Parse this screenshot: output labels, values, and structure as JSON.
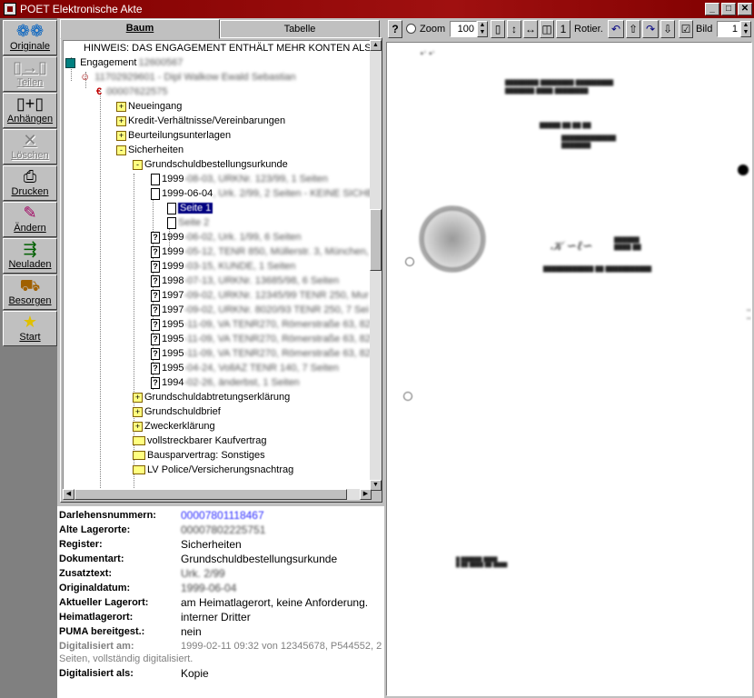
{
  "window": {
    "title": "POET Elektronische Akte",
    "buttons": [
      "_",
      "□",
      "✕"
    ]
  },
  "toolbar": [
    {
      "label": "Originale",
      "icon": "originals-icon",
      "enabled": true
    },
    {
      "label": "Teilen",
      "icon": "split-icon",
      "enabled": false
    },
    {
      "label": "Anhängen",
      "icon": "append-icon",
      "enabled": true
    },
    {
      "label": "Löschen",
      "icon": "delete-icon",
      "enabled": false
    },
    {
      "label": "Drucken",
      "icon": "printer-icon",
      "enabled": true
    },
    {
      "label": "Ändern",
      "icon": "edit-icon",
      "enabled": true
    },
    {
      "label": "Neuladen",
      "icon": "reload-icon",
      "enabled": true
    },
    {
      "label": "Besorgen",
      "icon": "fetch-icon",
      "enabled": true
    },
    {
      "label": "Start",
      "icon": "star-icon",
      "enabled": true
    }
  ],
  "tabs": {
    "baum": "Baum",
    "tabelle": "Tabelle",
    "active": "Baum"
  },
  "tree": {
    "hint": "HINWEIS: DAS ENGAGEMENT ENTHÄLT MEHR KONTEN ALS",
    "engagement": "Engagement 12600567",
    "customer": "11702929601 - Dipl Walkow Ewald Sebastian",
    "account": "00007622575",
    "folders1": [
      "Neueingang",
      "Kredit-Verhältnisse/Vereinbarungen",
      "Beurteilungsunterlagen",
      "Sicherheiten"
    ],
    "subfolder": "Grundschuldbestellungsurkunde",
    "docs_top": [
      {
        "date": "1999",
        "rest": "-08-03, URKNr. 123/99, 1 Seiten"
      },
      {
        "date": "1999-06-04",
        "rest": ", Urk. 2/99, 2 Seiten - KEINE SICHE"
      }
    ],
    "pages": [
      "Seite 1",
      "Seite 2"
    ],
    "docs_more": [
      {
        "date": "1999",
        "rest": "-06-02, Urk. 1/99, 6 Seiten"
      },
      {
        "date": "1999",
        "rest": "-05-12, TENR 850, Müllerstr. 3, München,"
      },
      {
        "date": "1999",
        "rest": "-03-15, KUNDE, 1 Seiten"
      },
      {
        "date": "1998",
        "rest": "-07-13, URKNr. 13685/98, 6 Seiten"
      },
      {
        "date": "1997",
        "rest": "-09-02, URKNr. 12345/99 TENR 250, Mur"
      },
      {
        "date": "1997",
        "rest": "-09-02, URKNr. 8020/93 TENR 250, 7 Sei"
      },
      {
        "date": "1995",
        "rest": "-11-09, VA TENR270, Römerstraße 63, 825"
      },
      {
        "date": "1995",
        "rest": "-11-09, VA TENR270, Römerstraße 63, 825"
      },
      {
        "date": "1995",
        "rest": "-11-09, VA TENR270, Römerstraße 63, 825"
      },
      {
        "date": "1995",
        "rest": "-04-24, VollAZ TENR 140, 7 Seiten"
      },
      {
        "date": "1994",
        "rest": "-02-26, änderbst, 1 Seiten"
      }
    ],
    "folders2": [
      "Grundschuldabtretungserklärung",
      "Grundschuldbrief",
      "Zweckerklärung"
    ],
    "folders3": [
      "vollstreckbarer Kaufvertrag",
      "Bausparvertrag: Sonstiges",
      "LV Police/Versicherungsnachtrag"
    ]
  },
  "details": [
    {
      "key": "Darlehensnummern:",
      "value": "00007801118467",
      "style": "link"
    },
    {
      "key": "Alte Lagerorte:",
      "value": "00007802225751",
      "style": "blur"
    },
    {
      "key": "Register:",
      "value": "Sicherheiten",
      "style": ""
    },
    {
      "key": "Dokumentart:",
      "value": "Grundschuldbestellungsurkunde",
      "style": ""
    },
    {
      "key": "Zusatztext:",
      "value": "Urk. 2/99",
      "style": "blur"
    },
    {
      "key": "Originaldatum:",
      "value": "1999-06-04",
      "style": "blur"
    },
    {
      "key": "Aktueller Lagerort:",
      "value": "am Heimatlagerort, keine Anforderung.",
      "style": ""
    },
    {
      "key": "Heimatlagerort:",
      "value": "interner Dritter",
      "style": ""
    },
    {
      "key": "PUMA bereitgest.:",
      "value": "nein",
      "style": ""
    }
  ],
  "digital": {
    "key": "Digitalisiert am:",
    "value": "1999-02-11 09:32 von 12345678, P544552, 2",
    "cont": "Seiten, vollständig digitalisiert.",
    "key2": "Digitalisiert als:",
    "value2": "Kopie"
  },
  "viewer": {
    "help": "?",
    "zoom_label": "Zoom",
    "zoom_value": "100",
    "rotate_label": "Rotier.",
    "page_label": "Bild",
    "page_value": "1"
  }
}
